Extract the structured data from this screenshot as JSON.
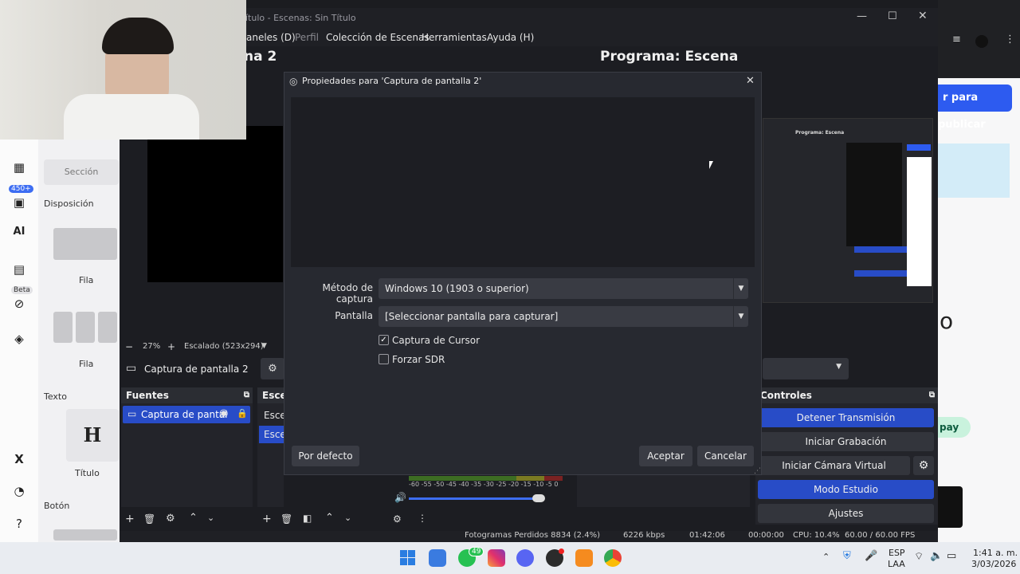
{
  "obs": {
    "window_title": "ítulo - Escenas: Sin Título",
    "menu": [
      "aneles (D)",
      "Perfil",
      "Colección de Escenas",
      "Herramientas",
      "Ayuda (H)"
    ],
    "preview_title": "na 2",
    "program_title": "Programa: Escena",
    "zoom_minus": "−",
    "zoom_value": "27%",
    "zoom_plus": "+",
    "scaling": "Escalado (523x294)",
    "source_bar_name": "Captura de pantalla 2",
    "docks": {
      "sources_title": "Fuentes",
      "sources": [
        {
          "name": "Captura de pantal"
        }
      ],
      "scenes_title": "Escer",
      "scenes": [
        "Escer",
        "Escen"
      ],
      "controls_title": "Controles"
    },
    "audio_scale": [
      "-60",
      "-55",
      "-50",
      "-45",
      "-40",
      "-35",
      "-30",
      "-25",
      "-20",
      "-15",
      "-10",
      "-5",
      "0"
    ],
    "controls": {
      "stop_stream": "Detener Transmisión",
      "start_recording": "Iniciar Grabación",
      "start_virtual_cam": "Iniciar Cámara Virtual",
      "studio_mode": "Modo Estudio",
      "settings": "Ajustes"
    },
    "status": {
      "dropped_frames": "Fotogramas Perdidos 8834 (2.4%)",
      "bitrate": "6226 kbps",
      "stream_time": "01:42:06",
      "rec_time": "00:00:00",
      "cpu": "CPU: 10.4%",
      "fps": "60.00 / 60.00 FPS"
    }
  },
  "dialog": {
    "title": "Propiedades para 'Captura de pantalla 2'",
    "capture_method_label": "Método de captura",
    "capture_method_value": "Windows 10 (1903 o superior)",
    "screen_label": "Pantalla",
    "screen_value": "[Seleccionar pantalla para capturar]",
    "capture_cursor_label": "Captura de Cursor",
    "capture_cursor_checked": true,
    "force_sdr_label": "Forzar SDR",
    "force_sdr_checked": false,
    "defaults_button": "Por defecto",
    "accept_button": "Aceptar",
    "cancel_button": "Cancelar"
  },
  "left_web": {
    "badge_count": "450+",
    "beta_label": "Beta",
    "section_button": "Sección",
    "layout_heading": "Disposición",
    "row_label_1": "Fila",
    "row_label_2": "Fila",
    "text_heading": "Texto",
    "title_label": "Título",
    "button_heading": "Botón"
  },
  "right_web": {
    "publish_button": "r para publicar",
    "big_letter": "o",
    "pay_label": "pay"
  },
  "taskbar": {
    "whatsapp_badge": "49",
    "language": "ESP",
    "layout": "LAA",
    "time": "1:41 a. m.",
    "date": "3/03/2026"
  },
  "colors": {
    "accent_blue": "#284cc7",
    "dialog_bg": "#272930",
    "obs_bg": "#1c1d22",
    "publish_blue": "#2d5bf0"
  }
}
